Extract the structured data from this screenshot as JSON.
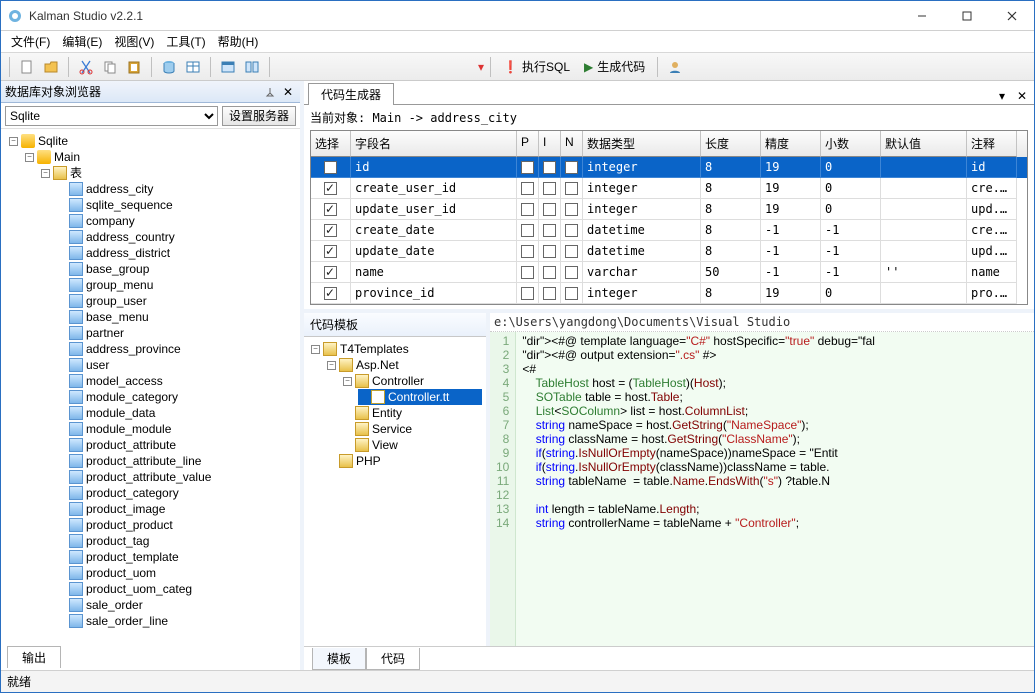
{
  "window": {
    "title": "Kalman Studio v2.2.1"
  },
  "menubar": [
    "文件(F)",
    "编辑(E)",
    "视图(V)",
    "工具(T)",
    "帮助(H)"
  ],
  "toolbar": {
    "exec_sql": "执行SQL",
    "gen_code": "生成代码"
  },
  "left": {
    "panel_title": "数据库对象浏览器",
    "combo_selected": "Sqlite",
    "set_server_btn": "设置服务器",
    "root": "Sqlite",
    "db": "Main",
    "tables_label": "表",
    "tables": [
      "address_city",
      "sqlite_sequence",
      "company",
      "address_country",
      "address_district",
      "base_group",
      "group_menu",
      "group_user",
      "base_menu",
      "partner",
      "address_province",
      "user",
      "model_access",
      "module_category",
      "module_data",
      "module_module",
      "product_attribute",
      "product_attribute_line",
      "product_attribute_value",
      "product_category",
      "product_image",
      "product_product",
      "product_tag",
      "product_template",
      "product_uom",
      "product_uom_categ",
      "sale_order",
      "sale_order_line"
    ]
  },
  "right": {
    "tab": "代码生成器",
    "cur_obj_label": "当前对象: Main -> address_city",
    "grid_headers": [
      "选择",
      "字段名",
      "P",
      "I",
      "N",
      "数据类型",
      "长度",
      "精度",
      "小数",
      "默认值",
      "注释"
    ],
    "rows": [
      {
        "sel": true,
        "name": "id",
        "p": false,
        "i": false,
        "n": false,
        "type": "integer",
        "len": "8",
        "prec": "19",
        "scale": "0",
        "def": "",
        "note": "id",
        "hl": true
      },
      {
        "sel": true,
        "name": "create_user_id",
        "p": false,
        "i": false,
        "n": false,
        "type": "integer",
        "len": "8",
        "prec": "19",
        "scale": "0",
        "def": "",
        "note": "cre..."
      },
      {
        "sel": true,
        "name": "update_user_id",
        "p": false,
        "i": false,
        "n": false,
        "type": "integer",
        "len": "8",
        "prec": "19",
        "scale": "0",
        "def": "",
        "note": "upd..."
      },
      {
        "sel": true,
        "name": "create_date",
        "p": false,
        "i": false,
        "n": false,
        "type": "datetime",
        "len": "8",
        "prec": "-1",
        "scale": "-1",
        "def": "",
        "note": "cre..."
      },
      {
        "sel": true,
        "name": "update_date",
        "p": false,
        "i": false,
        "n": false,
        "type": "datetime",
        "len": "8",
        "prec": "-1",
        "scale": "-1",
        "def": "",
        "note": "upd..."
      },
      {
        "sel": true,
        "name": "name",
        "p": false,
        "i": false,
        "n": false,
        "type": "varchar",
        "len": "50",
        "prec": "-1",
        "scale": "-1",
        "def": "''",
        "note": "name"
      },
      {
        "sel": true,
        "name": "province_id",
        "p": false,
        "i": false,
        "n": false,
        "type": "integer",
        "len": "8",
        "prec": "19",
        "scale": "0",
        "def": "",
        "note": "pro..."
      }
    ],
    "template_panel": "代码模板",
    "template_root": "T4Templates",
    "template_tree": {
      "AspNet": "Asp.Net",
      "Controller": "Controller",
      "ControllerTT": "Controller.tt",
      "Entity": "Entity",
      "Service": "Service",
      "View": "View",
      "PHP": "PHP"
    },
    "code_path": "e:\\Users\\yangdong\\Documents\\Visual Studio",
    "code_lines": [
      "<#@ template language=\"C#\" hostSpecific=\"true\" debug=\"fal",
      "<#@ output extension=\".cs\" #>",
      "<#",
      "    TableHost host = (TableHost)(Host);",
      "    SOTable table = host.Table;",
      "    List<SOColumn> list = host.ColumnList;",
      "    string nameSpace = host.GetString(\"NameSpace\");",
      "    string className = host.GetString(\"ClassName\");",
      "    if(string.IsNullOrEmpty(nameSpace))nameSpace = \"Entit",
      "    if(string.IsNullOrEmpty(className))className = table.",
      "    string tableName  = table.Name.EndsWith(\"s\") ?table.N",
      "",
      "    int length = tableName.Length;",
      "    string controllerName = tableName + \"Controller\";"
    ],
    "bottom_tabs": [
      "模板",
      "代码"
    ]
  },
  "output_tab": "输出",
  "status": "就绪"
}
